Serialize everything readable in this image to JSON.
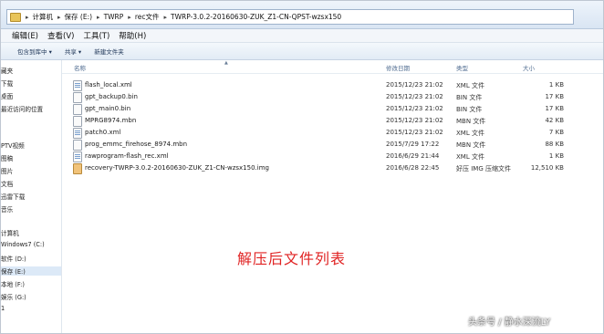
{
  "address_bar": {
    "crumbs": [
      "计算机",
      "保存 (E:)",
      "TWRP",
      "rec文件",
      "TWRP-3.0.2-20160630-ZUK_Z1-CN-QPST-wzsx150"
    ]
  },
  "menu": [
    "编辑(E)",
    "查看(V)",
    "工具(T)",
    "帮助(H)"
  ],
  "toolbar": {
    "include": "包含到库中 ▾",
    "share": "共享 ▾",
    "new_folder": "新建文件夹"
  },
  "sidebar": [
    "藏夹",
    "下载",
    "桌面",
    "最近访问的位置",
    "PTV视频",
    "图稿",
    "图片",
    "文档",
    "迅雷下载",
    "音乐",
    "计算机",
    "Windows7 (C:)",
    "软件 (D:)",
    "保存 (E:)",
    "本地 (F:)",
    "娱乐 (G:)",
    "1"
  ],
  "columns": {
    "name": "名称",
    "date": "修改日期",
    "type": "类型",
    "size": "大小"
  },
  "files": [
    {
      "name": "flash_local.xml",
      "date": "2015/12/23 21:02",
      "type": "XML 文件",
      "size": "1 KB",
      "icon": "xml-file-icon"
    },
    {
      "name": "gpt_backup0.bin",
      "date": "2015/12/23 21:02",
      "type": "BIN 文件",
      "size": "17 KB",
      "icon": "bin-file-icon"
    },
    {
      "name": "gpt_main0.bin",
      "date": "2015/12/23 21:02",
      "type": "BIN 文件",
      "size": "17 KB",
      "icon": "bin-file-icon"
    },
    {
      "name": "MPRG8974.mbn",
      "date": "2015/12/23 21:02",
      "type": "MBN 文件",
      "size": "42 KB",
      "icon": "mbn-file-icon"
    },
    {
      "name": "patch0.xml",
      "date": "2015/12/23 21:02",
      "type": "XML 文件",
      "size": "7 KB",
      "icon": "xml-file-icon"
    },
    {
      "name": "prog_emmc_firehose_8974.mbn",
      "date": "2015/7/29 17:22",
      "type": "MBN 文件",
      "size": "88 KB",
      "icon": "mbn-file-icon"
    },
    {
      "name": "rawprogram-flash_rec.xml",
      "date": "2016/6/29 21:44",
      "type": "XML 文件",
      "size": "1 KB",
      "icon": "xml-file-icon"
    },
    {
      "name": "recovery-TWRP-3.0.2-20160630-ZUK_Z1-CN-wzsx150.img",
      "date": "2016/6/28 22:45",
      "type": "好压 IMG 压缩文件",
      "size": "12,510 KB",
      "icon": "img-archive-icon"
    }
  ],
  "caption": "解压后文件列表",
  "watermark": "头条号 / 静水深流LY"
}
